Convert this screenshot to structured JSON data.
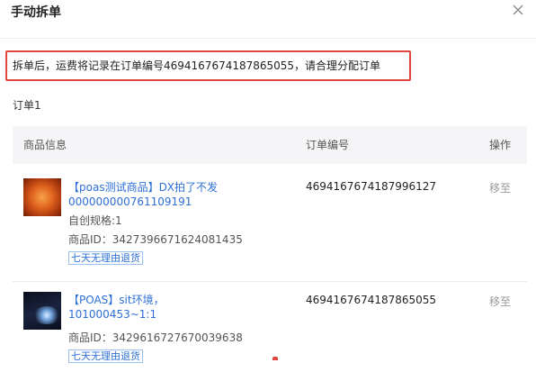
{
  "dialog": {
    "title": "手动拆单",
    "notice": "拆单后，运费将记录在订单编号4694167674187865055，请合理分配订单"
  },
  "order": {
    "label": "订单1",
    "columns": {
      "product": "商品信息",
      "order_no": "订单编号",
      "action": "操作"
    },
    "rows": [
      {
        "name": "【poas测试商品】DX拍了不发000000000761109191",
        "spec": "自创规格:1",
        "product_id": "商品ID：3427396671624081435",
        "badge": "七天无理由退货",
        "order_no": "4694167674187996127",
        "action": "移至"
      },
      {
        "name": "【POAS】sit环境，101000453~1:1",
        "product_id": "商品ID：3429616727670039638",
        "badge": "七天无理由退货",
        "order_no": "4694167674187865055",
        "action": "移至"
      }
    ]
  },
  "colors": {
    "accent": "#2d6fd6",
    "highlight_border": "#e0463e",
    "header_bg": "#f5f5f7"
  }
}
